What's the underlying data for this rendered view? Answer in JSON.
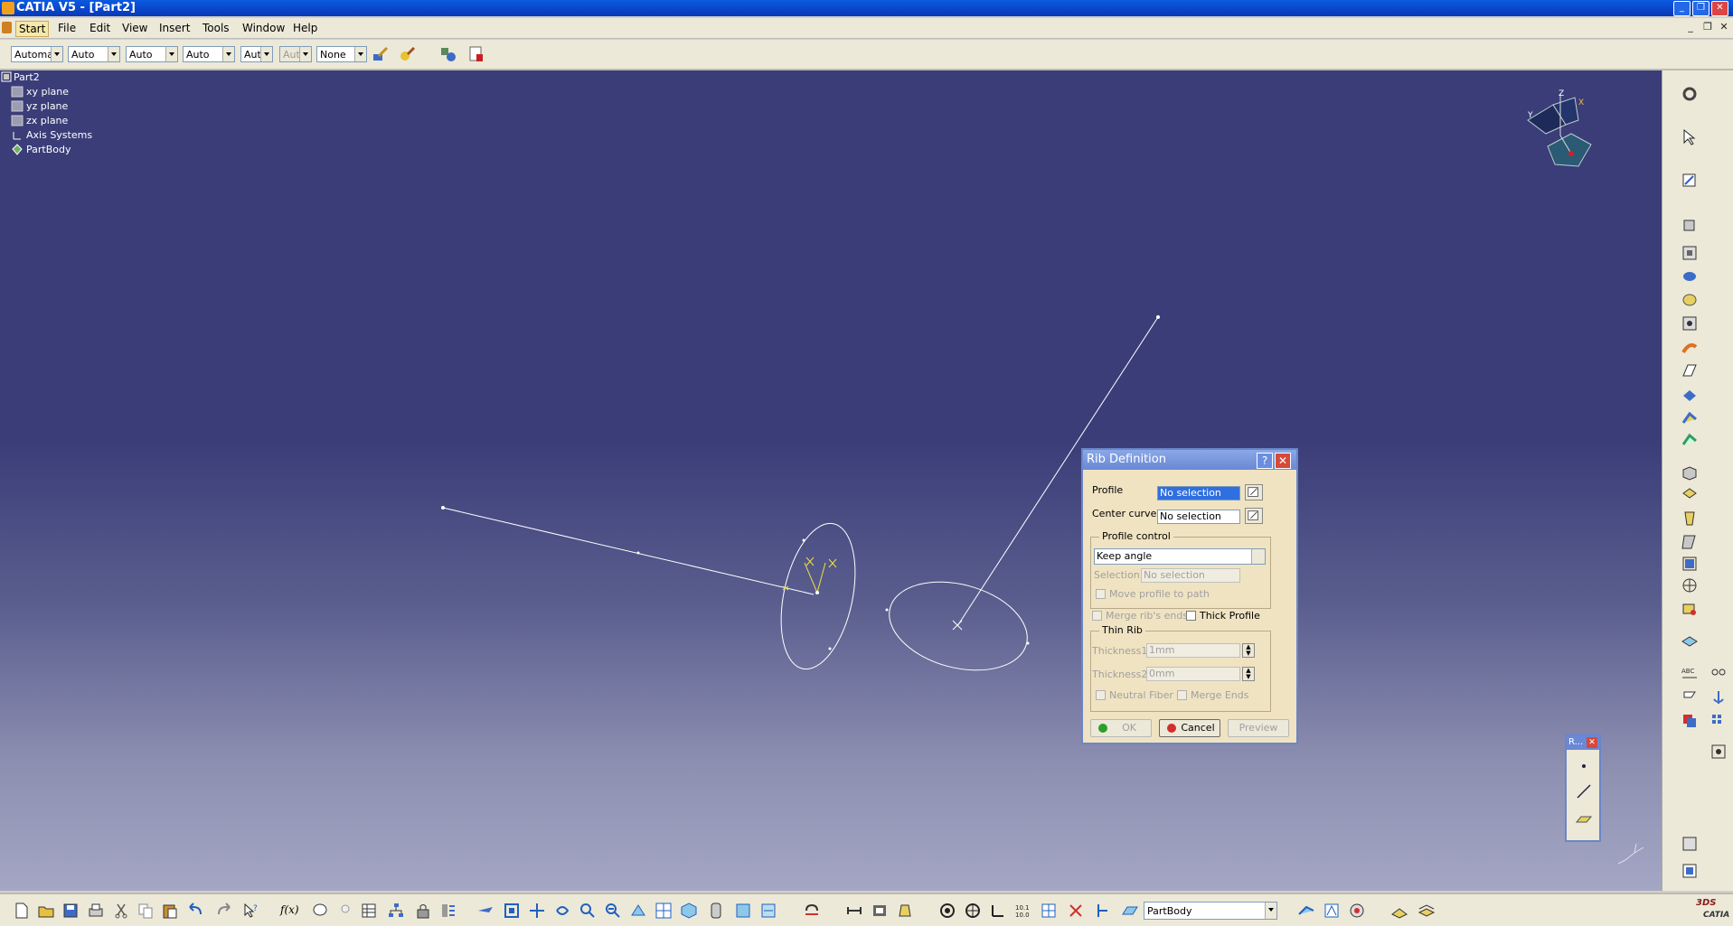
{
  "window": {
    "title": "CATIA V5 - [Part2]"
  },
  "menu": {
    "items": [
      "Start",
      "File",
      "Edit",
      "View",
      "Insert",
      "Tools",
      "Window",
      "Help"
    ]
  },
  "toolbar": {
    "combos": [
      {
        "value": "Automa",
        "disabled": false
      },
      {
        "value": "Auto",
        "disabled": false
      },
      {
        "value": "Auto",
        "disabled": false
      },
      {
        "value": "Auto",
        "disabled": false
      },
      {
        "value": "Aut",
        "disabled": false
      },
      {
        "value": "Aut",
        "disabled": true
      },
      {
        "value": "None",
        "disabled": false
      }
    ]
  },
  "tree": {
    "root": "Part2",
    "items": [
      "xy plane",
      "yz plane",
      "zx plane",
      "Axis Systems",
      "PartBody"
    ]
  },
  "compass": {
    "axes": [
      "Z",
      "Y",
      "X"
    ]
  },
  "rib_dialog": {
    "title": "Rib Definition",
    "help": "?",
    "close": "✕",
    "profile_label": "Profile",
    "profile_value": "No selection",
    "center_curve_label": "Center curve",
    "center_curve_value": "No selection",
    "profile_control_title": "Profile control",
    "profile_control_value": "Keep angle",
    "selection_label": "Selection:",
    "selection_value": "No selection",
    "move_profile_label": "Move profile to path",
    "merge_rib_ends_label": "Merge rib's ends",
    "thick_profile_label": "Thick Profile",
    "thin_rib_title": "Thin Rib",
    "thickness1_label": "Thickness1:",
    "thickness1_value": "1mm",
    "thickness2_label": "Thickness2:",
    "thickness2_value": "0mm",
    "neutral_fiber_label": "Neutral Fiber",
    "merge_ends_label": "Merge Ends",
    "ok_label": "OK",
    "cancel_label": "Cancel",
    "preview_label": "Preview"
  },
  "small_toolbar": {
    "title": "R...",
    "close": "✕"
  },
  "bottom": {
    "fx_label": "f(x)",
    "partbody_value": "PartBody",
    "catia_logo": "CATIA",
    "ds_logo": "3DS"
  },
  "colors": {
    "viewport_top": "#3a3d78",
    "viewport_bottom": "#a4a6c4",
    "dialog_bg": "#f0e3c2",
    "title_bar": "#0a5ae0"
  }
}
